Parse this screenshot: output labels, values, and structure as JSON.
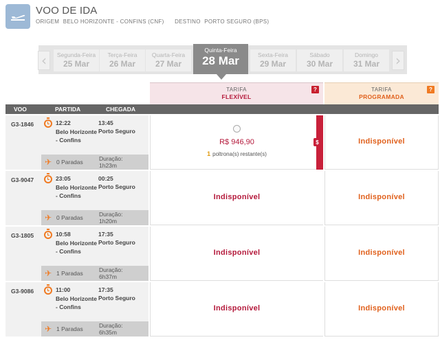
{
  "header": {
    "title": "VOO DE IDA",
    "origin_label": "ORIGEM",
    "origin": "BELO HORIZONTE - CONFINS (CNF)",
    "dest_label": "DESTINO",
    "dest": "PORTO SEGURO (BPS)",
    "icon": "plane-departure-icon"
  },
  "datebar": {
    "prev_icon": "chevron-left-icon",
    "next_icon": "chevron-right-icon",
    "days": [
      {
        "weekday": "Segunda-Feira",
        "date": "25 Mar"
      },
      {
        "weekday": "Terça-Feira",
        "date": "26 Mar"
      },
      {
        "weekday": "Quarta-Feira",
        "date": "27 Mar"
      },
      {
        "weekday": "Quinta-Feira",
        "date": "28 Mar"
      },
      {
        "weekday": "Sexta-Feira",
        "date": "29 Mar"
      },
      {
        "weekday": "Sábado",
        "date": "30 Mar"
      },
      {
        "weekday": "Domingo",
        "date": "31 Mar"
      }
    ],
    "selected_index": 3
  },
  "fares": {
    "flex": {
      "label": "TARIFA",
      "name": "FLEXÍVEL",
      "help": "?"
    },
    "prog": {
      "label": "TARIFA",
      "name": "PROGRAMADA",
      "help": "?"
    }
  },
  "columns": {
    "flight": "VOO",
    "dep": "PARTIDA",
    "arr": "CHEGADA"
  },
  "flights": [
    {
      "number": "G3-1846",
      "dep_time": "12:22",
      "dep_city": "Belo Horizonte - Confins",
      "arr_time": "13:45",
      "arr_city": "Porto Seguro",
      "stops": "0 Paradas",
      "duration_label": "Duração:",
      "duration": "1h23m",
      "flex": {
        "price": "R$ 946,90",
        "seats_count": "1",
        "seats_text": "poltrona(s) restante(s)"
      },
      "prog": "Indisponível"
    },
    {
      "number": "G3-9047",
      "dep_time": "23:05",
      "dep_city": "Belo Horizonte - Confins",
      "arr_time": "00:25",
      "arr_city": "Porto Seguro",
      "stops": "0 Paradas",
      "duration_label": "Duração:",
      "duration": "1h20m",
      "flex_unavailable": "Indisponível",
      "prog": "Indisponível"
    },
    {
      "number": "G3-1805",
      "dep_time": "10:58",
      "dep_city": "Belo Horizonte - Confins",
      "arr_time": "17:35",
      "arr_city": "Porto Seguro",
      "stops": "1 Paradas",
      "duration_label": "Duração:",
      "duration": "6h37m",
      "flex_unavailable": "Indisponível",
      "prog": "Indisponível"
    },
    {
      "number": "G3-9086",
      "dep_time": "11:00",
      "dep_city": "Belo Horizonte - Confins",
      "arr_time": "17:35",
      "arr_city": "Porto Seguro",
      "stops": "1 Paradas",
      "duration_label": "Duração:",
      "duration": "6h35m",
      "flex_unavailable": "Indisponível",
      "prog": "Indisponível"
    }
  ],
  "selected_marker": "$",
  "colors": {
    "flex": "#b4193b",
    "prog": "#e0601c",
    "accent_orange": "#f07a22"
  }
}
